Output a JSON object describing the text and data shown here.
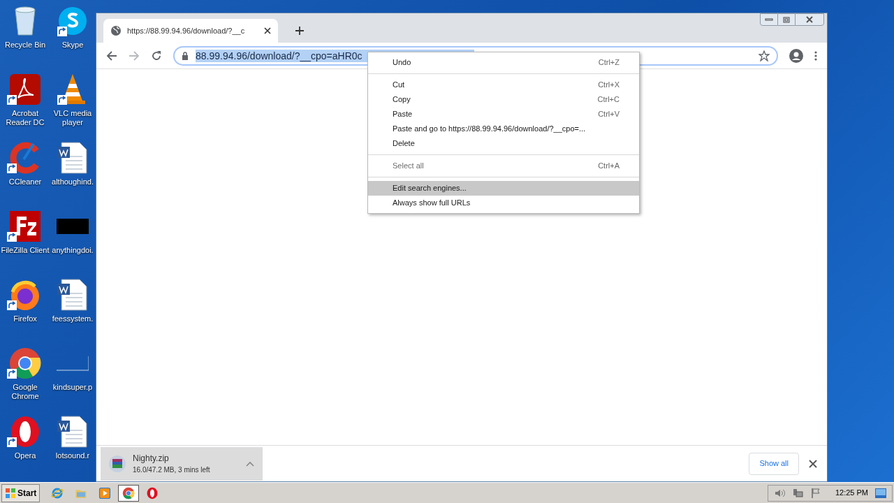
{
  "desktop_icons": [
    {
      "label": "Recycle Bin",
      "kind": "recycle",
      "shortcut": false
    },
    {
      "label": "Skype",
      "kind": "skype",
      "shortcut": true
    },
    {
      "label": "Acrobat Reader DC",
      "kind": "acrobat",
      "shortcut": true
    },
    {
      "label": "VLC media player",
      "kind": "vlc",
      "shortcut": true
    },
    {
      "label": "CCleaner",
      "kind": "ccleaner",
      "shortcut": true
    },
    {
      "label": "althoughind.",
      "kind": "word",
      "shortcut": false
    },
    {
      "label": "FileZilla Client",
      "kind": "filezilla",
      "shortcut": true
    },
    {
      "label": "anythingdoi.",
      "kind": "dark",
      "shortcut": false
    },
    {
      "label": "Firefox",
      "kind": "firefox",
      "shortcut": true
    },
    {
      "label": "feessystem.",
      "kind": "word",
      "shortcut": false
    },
    {
      "label": "Google Chrome",
      "kind": "chrome",
      "shortcut": true
    },
    {
      "label": "kindsuper.p",
      "kind": "blank",
      "shortcut": false
    },
    {
      "label": "Opera",
      "kind": "opera",
      "shortcut": true
    },
    {
      "label": "lotsound.r",
      "kind": "word",
      "shortcut": false
    }
  ],
  "browser": {
    "tab": {
      "title": "https://88.99.94.96/download/?__c"
    },
    "address": {
      "value": "88.99.94.96/download/?__cpo=aHR0c",
      "selected": true
    },
    "forward_disabled": true,
    "context_menu": [
      [
        {
          "label": "Undo",
          "shortcut": "Ctrl+Z",
          "disabled": false,
          "selected": false
        }
      ],
      [
        {
          "label": "Cut",
          "shortcut": "Ctrl+X",
          "disabled": false,
          "selected": false
        },
        {
          "label": "Copy",
          "shortcut": "Ctrl+C",
          "disabled": false,
          "selected": false
        },
        {
          "label": "Paste",
          "shortcut": "Ctrl+V",
          "disabled": false,
          "selected": false
        },
        {
          "label": "Paste and go to https://88.99.94.96/download/?__cpo=...",
          "disabled": false,
          "selected": false
        },
        {
          "label": "Delete",
          "disabled": false,
          "selected": false
        }
      ],
      [
        {
          "label": "Select all",
          "shortcut": "Ctrl+A",
          "disabled": true,
          "selected": false
        }
      ],
      [
        {
          "label": "Edit search engines...",
          "disabled": false,
          "selected": true
        },
        {
          "label": "Always show full URLs",
          "disabled": false,
          "selected": false
        }
      ]
    ],
    "download": {
      "file": "Nighty.zip",
      "status": "16.0/47.2 MB, 3 mins left",
      "show_all": "Show all"
    }
  },
  "taskbar": {
    "start": "Start",
    "apps": [
      {
        "kind": "ie",
        "selected": false
      },
      {
        "kind": "folder",
        "selected": false
      },
      {
        "kind": "media",
        "selected": false
      },
      {
        "kind": "chrome",
        "selected": true
      },
      {
        "kind": "opera",
        "selected": false
      }
    ],
    "clock": "12:25 PM"
  }
}
